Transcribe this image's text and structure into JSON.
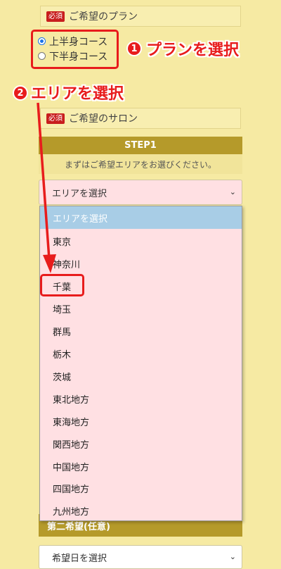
{
  "plan_section": {
    "badge": "必須",
    "label": "ご希望のプラン",
    "options": [
      {
        "label": "上半身コース",
        "checked": true
      },
      {
        "label": "下半身コース",
        "checked": false
      }
    ]
  },
  "callout_1": {
    "number": "1",
    "text": "プランを選択"
  },
  "callout_2": {
    "number": "2",
    "text": "エリアを選択"
  },
  "salon_section": {
    "badge": "必須",
    "label": "ご希望のサロン"
  },
  "step1": {
    "header": "STEP1",
    "description": "まずはご希望エリアをお選びください。"
  },
  "area_select": {
    "value": "エリアを選択",
    "options": [
      "エリアを選択",
      "東京",
      "神奈川",
      "千葉",
      "埼玉",
      "群馬",
      "栃木",
      "茨城",
      "東北地方",
      "東海地方",
      "関西地方",
      "中国地方",
      "四国地方",
      "九州地方"
    ],
    "selected_index": 0,
    "highlighted_option": "千葉"
  },
  "second_choice": {
    "label": "第二希望(任意)"
  },
  "date_select": {
    "value": "希望日を選択"
  },
  "colors": {
    "background": "#f6eaa3",
    "accent_olive": "#b59a2a",
    "annotation_red": "#e81c1c",
    "dropdown_bg": "#ffe0e3",
    "dropdown_selected": "#a8cde6"
  }
}
